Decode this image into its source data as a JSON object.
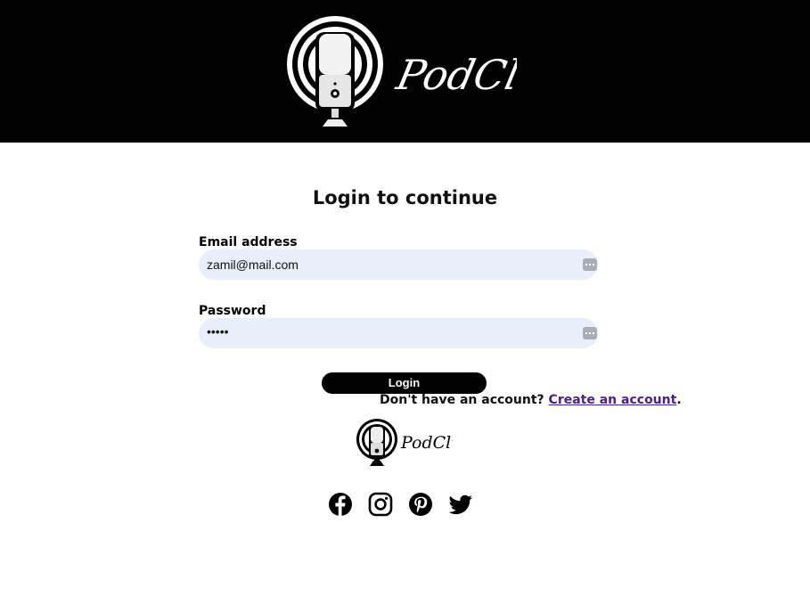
{
  "header": {
    "brand": "PodClub"
  },
  "form": {
    "title": "Login to continue",
    "email_label": "Email address",
    "email_value": "zamil@mail.com",
    "password_label": "Password",
    "password_value": "•••••",
    "login_button": "Login"
  },
  "signup": {
    "prompt": "Don't have an account?",
    "link_text": "Create an account",
    "suffix": "."
  },
  "footer": {
    "brand": "PodClub",
    "social_icons": [
      "facebook-icon",
      "instagram-icon",
      "pinterest-icon",
      "twitter-icon"
    ]
  },
  "colors": {
    "header_bg": "#000000",
    "field_bg": "#e8effb",
    "link": "#4b1f86"
  }
}
